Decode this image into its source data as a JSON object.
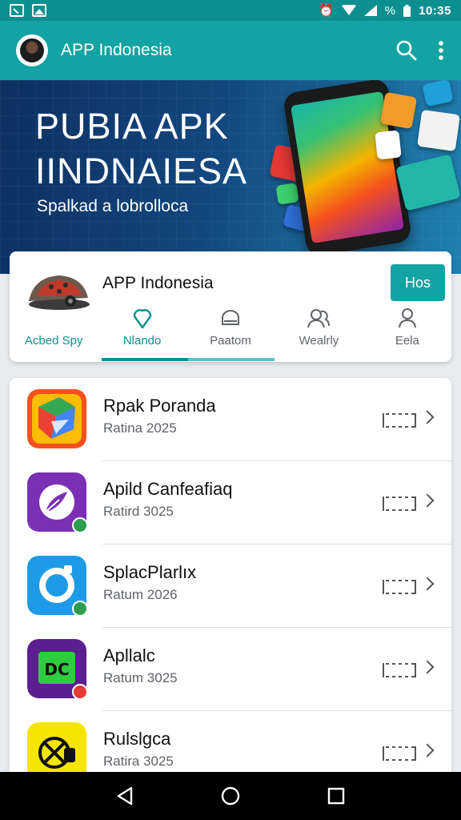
{
  "status_bar": {
    "time": "10:35",
    "percent_glyph": "%",
    "icons": [
      "image-icon",
      "arrow-icon",
      "alarm-icon",
      "wifi-icon",
      "signal-icon",
      "battery-icon"
    ]
  },
  "app_bar": {
    "title": "APP Indonesia",
    "actions": [
      "search-icon",
      "more-vert-icon"
    ]
  },
  "banner": {
    "headline_line1": "PUBIA APK",
    "headline_line2": "IINDNAIESA",
    "subtitle": "Spalkad a lobrolloca"
  },
  "card": {
    "title": "APP Indonesia",
    "button_label": "Hos",
    "tabs": [
      {
        "label": "Acbed Spy",
        "icon": "feature-image",
        "active": false,
        "teal": true
      },
      {
        "label": "Nlando",
        "icon": "heart-location-icon",
        "active": true,
        "teal": true
      },
      {
        "label": "Paatom",
        "icon": "chat-bubble-icon",
        "active": false,
        "teal": false
      },
      {
        "label": "Wealrly",
        "icon": "people-icon",
        "active": false,
        "teal": false
      },
      {
        "label": "Eela",
        "icon": "person-icon",
        "active": false,
        "teal": false
      }
    ]
  },
  "apps": [
    {
      "name": "Rpak Poranda",
      "subtitle": "Ratina 2025",
      "icon": "google-like-icon",
      "badge": null
    },
    {
      "name": "Apild Canfeafiaq",
      "subtitle": "Ratird 3025",
      "icon": "purple-feather-icon",
      "badge": "green"
    },
    {
      "name": "SplacPlarlıx",
      "subtitle": "Ratum 2026",
      "icon": "blue-ring-icon",
      "badge": "green"
    },
    {
      "name": "Apllalc",
      "subtitle": "Ratum 3025",
      "icon": "dc-icon",
      "badge": "red"
    },
    {
      "name": "Rulslgca",
      "subtitle": "Ratira 3025",
      "icon": "yellow-cross-icon",
      "badge": null
    }
  ],
  "colors": {
    "primary": "#14a3a3",
    "status_bar": "#0e8f8f",
    "banner_dark": "#0d2f60"
  }
}
